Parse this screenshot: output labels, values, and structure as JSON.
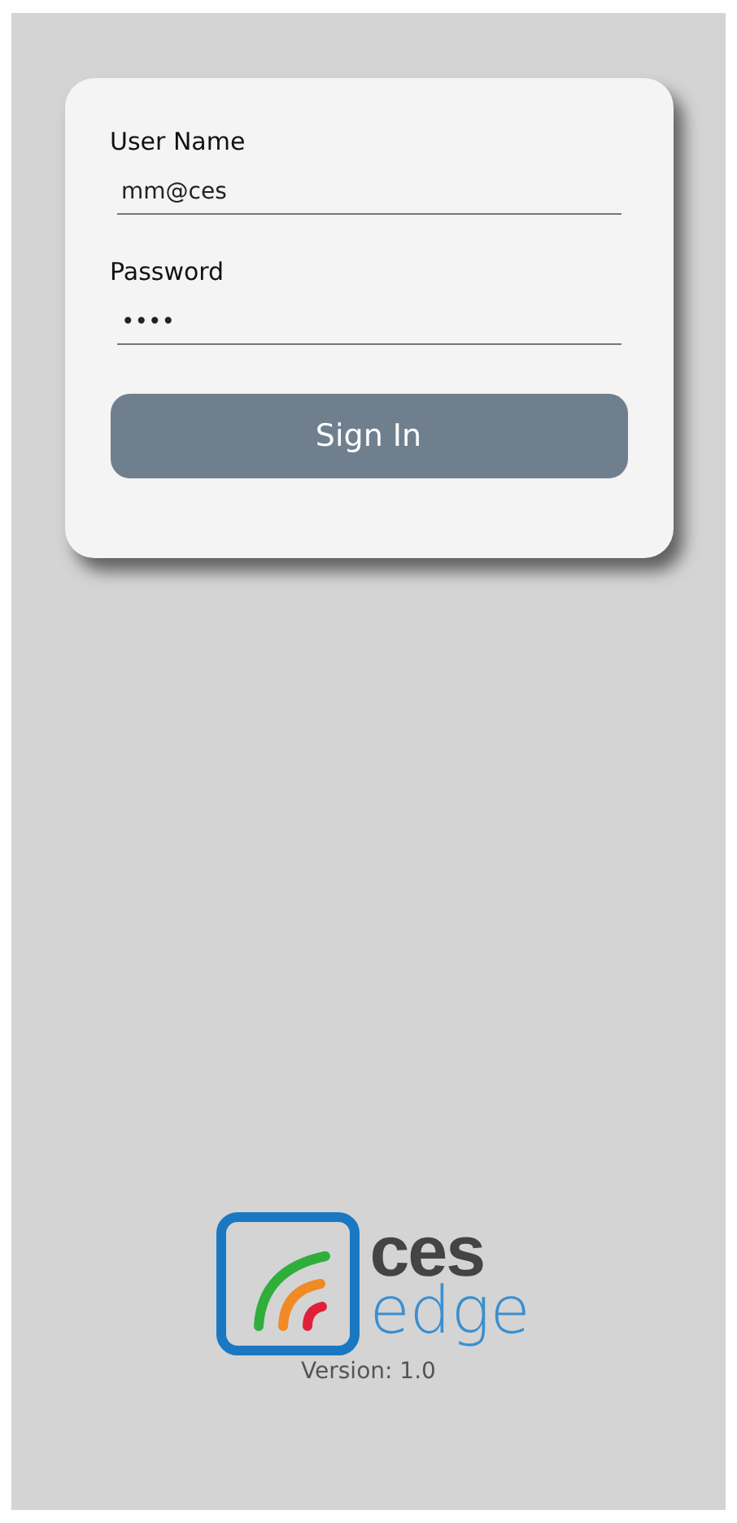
{
  "login_form": {
    "fields": [
      {
        "label": "User Name",
        "value": "mm@ces"
      },
      {
        "label": "Password",
        "value": "••••"
      }
    ],
    "button": "Sign In"
  },
  "logo": {
    "word_top": "ces",
    "word_bottom": "edge"
  },
  "version": "Version: 1.0"
}
